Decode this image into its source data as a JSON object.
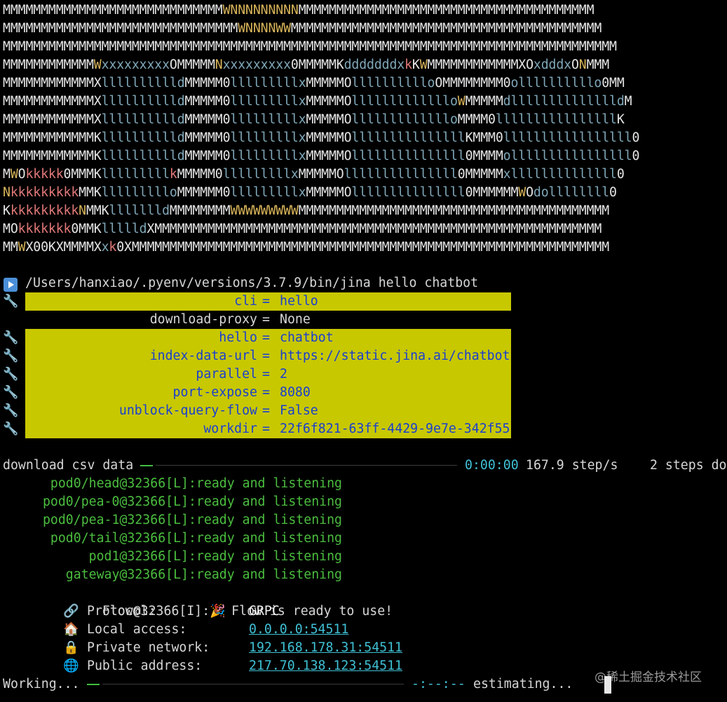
{
  "ascii_logo": [
    "MMMMMMMMMMMMMMMMMMMMMMMMMMMMMWNNNNNNNNNMMMMMMMMMMMMMMMMMMMMMMMMMMMMMMMMMMMMMMM",
    "MMMMMMMMMMMMMMMMMMMMMMMMMMMMMMMWNNNNWWMMMMMMMMMMMMMMMMMMMMMMMMMMMMMMMMMMMMMMMMM",
    "MMMMMMMMMMMMMMMMMMMMMMMMMMMMMMMMMMMMMMMMMMMMMMMMMMMMMMMMMMMMMMMMMMMMMMMMMMMMMMMMM",
    "MMMMMMMMMMMMWxxxxxxxxxOMMMMMNxxxxxxxxx0MMMMMKdddddddxkKWMMMMMMMMMMMMXOxdddxONMMM",
    "MMMMMMMMMMMMXlllllllllldMMMMM0lllllllllxMMMMMOlllllllllloOMMMMMMMM0ollllllllllo0MM",
    "MMMMMMMMMMMMXlllllllllldMMMMM0lllllllllxMMMMMOllllllllllllloWMMMMMdlllllllllllllldM",
    "MMMMMMMMMMMMXlllllllllldMMMMM0lllllllllxMMMMMOllllllllllllloMMMM0llllllllllllllllK",
    "MMMMMMMMMMMMKlllllllllldMMMMM0lllllllllxMMMMMOlllllllllllllllKMMM0lllllllllllllllll0",
    "MMMMMMMMMMMMKlllllllllldMMMMM0lllllllllxMMMMMOlllllllllllllll0MMMMollllllllllllllll0",
    "MWOkkkkk0MMMKlllllllllkMMMMM0lllllllllxMMMMMOlllllllllllllll0MMMMMxllllllllllllll0",
    "NkkkkkkkkkMMKllllllllloMMMMMM0lllllllllxMMMMMOlllllllllllllll0MMMMMMWOdollllllll0",
    "KkkkkkkkkkNMMKllllllldMMMMMMMMWWWWWWWWWMMMMMMMMMMMMMMMMMMMMMMMMMMMMMMMMMMMMMMMMM",
    "MOkkkkkkk0MMKllllldXMMMMMMMMMMMMMMMMMMMMMMMMMMMMMMMMMMMMMMMMMMMMMMMMMMMMMMMMMMM",
    "MMWX00KXMMMMXxk0XMMMMMMMMMMMMMMMMMMMMMMMMMMMMMMMMMMMMMMMMMMMMMMMMMMMMMMMMMMMMMMM"
  ],
  "command": "/Users/hanxiao/.pyenv/versions/3.7.9/bin/jina hello chatbot",
  "args": [
    {
      "key": "cli",
      "value": "hello",
      "highlight": true
    },
    {
      "key": "download-proxy",
      "value": "None",
      "highlight": false
    },
    {
      "key": "hello",
      "value": "chatbot",
      "highlight": true
    },
    {
      "key": "index-data-url",
      "value": "https://static.jina.ai/chatbot",
      "highlight": true
    },
    {
      "key": "parallel",
      "value": "2",
      "highlight": true
    },
    {
      "key": "port-expose",
      "value": "8080",
      "highlight": true
    },
    {
      "key": "unblock-query-flow",
      "value": "False",
      "highlight": true
    },
    {
      "key": "workdir",
      "value": "22f6f821-63ff-4429-9e7e-342f55",
      "highlight": true
    }
  ],
  "eq": "=",
  "download": {
    "label": "download csv data",
    "elapsed": "0:00:00",
    "rate": "167.9 step/s",
    "steps": "2 steps do",
    "progress": 0.04
  },
  "pods": [
    "pod0/head@32366[L]:ready and listening",
    "pod0/pea-0@32366[L]:ready and listening",
    "pod0/pea-1@32366[L]:ready and listening",
    "pod0/tail@32366[L]:ready and listening",
    "pod1@32366[L]:ready and listening",
    "gateway@32366[L]:ready and listening"
  ],
  "flow_ready": {
    "prefix": "Flow@32366[I]:",
    "emoji": "🎉",
    "text": " Flow is ready to use!"
  },
  "endpoints": [
    {
      "icon": "link-icon",
      "glyph": "🔗",
      "label": "Protocol:",
      "value": "GRPC",
      "link": false
    },
    {
      "icon": "house-icon",
      "glyph": "🏠",
      "label": "Local access:",
      "value": "0.0.0.0:54511",
      "link": true
    },
    {
      "icon": "lock-icon",
      "glyph": "🔒",
      "label": "Private network:",
      "value": "192.168.178.31:54511",
      "link": true
    },
    {
      "icon": "globe-icon",
      "glyph": "🌐",
      "label": "Public address:",
      "value": "217.70.138.123:54511",
      "link": true
    }
  ],
  "working": {
    "label": "Working...",
    "elapsed": "-:--:--",
    "status": "estimating...",
    "progress": 0.04
  },
  "watermark": "@稀土掘金技术社区",
  "colors": {
    "background": "#000000",
    "highlight": "#c8c800",
    "key_blue": "#1a3fd0",
    "green": "#4bbd3f",
    "cyan": "#3fc0d4"
  }
}
